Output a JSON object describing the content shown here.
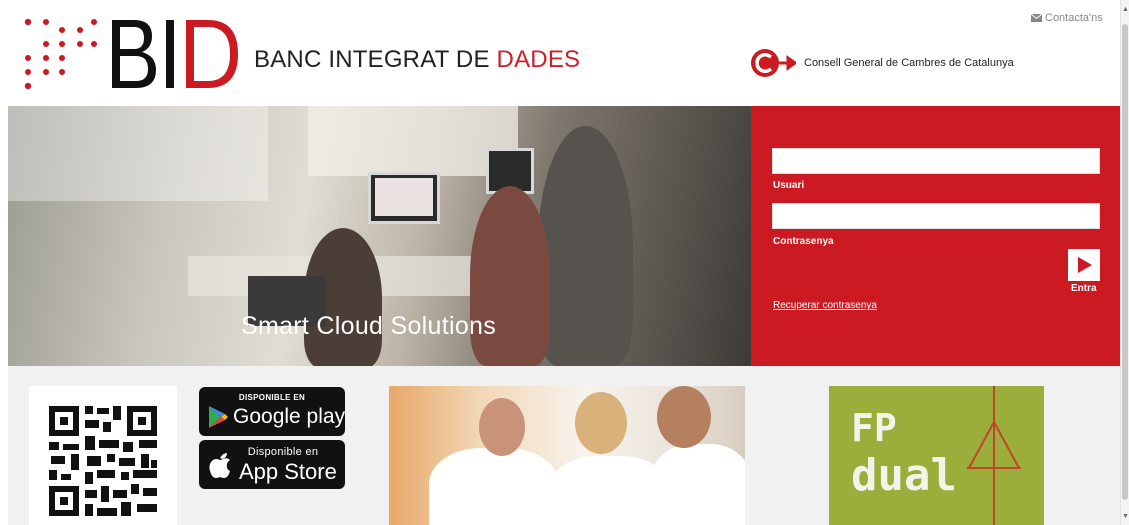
{
  "header": {
    "logo_text": "BID",
    "brand_prefix": "BANC INTEGRAT DE ",
    "brand_accent": "DADES",
    "contact_label": "Contacta'ns",
    "consell_text": "Consell General de Cambres de Catalunya"
  },
  "hero": {
    "caption": "Smart Cloud Solutions"
  },
  "login": {
    "username_label": "Usuari",
    "username_value": "",
    "password_label": "Contrasenya",
    "password_value": "",
    "enter_label": "Entra",
    "recover_label": "Recuperar contrasenya"
  },
  "promos": {
    "google_play_small": "DISPONIBLE EN",
    "google_play_big": "Google play",
    "app_store_small": "Disponible en",
    "app_store_big": "App Store",
    "fp_line1": "FP",
    "fp_line2": "dual"
  },
  "colors": {
    "brand_red": "#cc1a22",
    "fp_green": "#9bad3b",
    "strip_gray": "#f1f1f1"
  },
  "icons": {
    "contact": "envelope-icon",
    "enter": "play-arrow-icon",
    "google_play": "google-play-triangle-icon",
    "app_store": "apple-icon"
  }
}
